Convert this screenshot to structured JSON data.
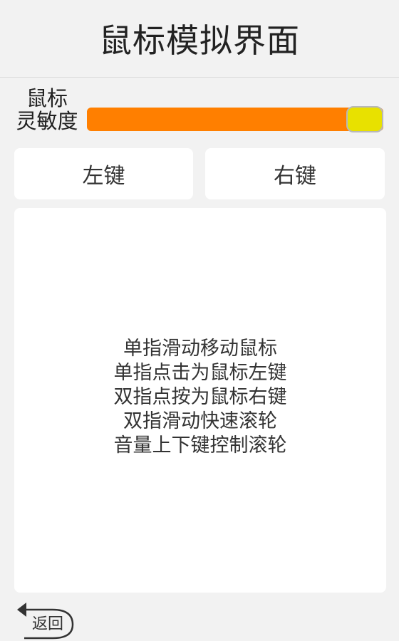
{
  "header": {
    "title": "鼠标模拟界面"
  },
  "sensitivity": {
    "label_line1": "鼠标",
    "label_line2": "灵敏度",
    "value": 1.0,
    "fill_color": "#ff7f00",
    "thumb_color": "#e8e100"
  },
  "buttons": {
    "left_label": "左键",
    "right_label": "右键"
  },
  "touchpad": {
    "instructions": [
      "单指滑动移动鼠标",
      "单指点击为鼠标左键",
      "双指点按为鼠标右键",
      "双指滑动快速滚轮",
      "音量上下键控制滚轮"
    ]
  },
  "footer": {
    "back_label": "返回",
    "back_icon": "back-arrow-icon"
  }
}
